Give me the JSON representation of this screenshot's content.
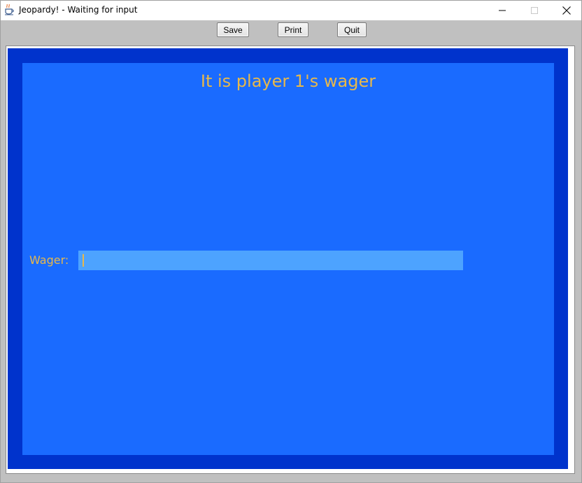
{
  "window": {
    "title": "Jeopardy! - Waiting for input",
    "app_icon": "java-coffee-cup-icon"
  },
  "title_controls": {
    "minimize_icon": "minimize-icon",
    "maximize_icon": "maximize-icon",
    "close_icon": "close-icon"
  },
  "toolbar": {
    "save_label": "Save",
    "print_label": "Print",
    "quit_label": "Quit"
  },
  "board": {
    "heading": "It is player 1's wager",
    "wager_label": "Wager:",
    "wager_value": "",
    "colors": {
      "outer_border": "#0033cc",
      "panel": "#1a6bff",
      "input": "#4da3ff",
      "text": "#e8b84a"
    }
  }
}
